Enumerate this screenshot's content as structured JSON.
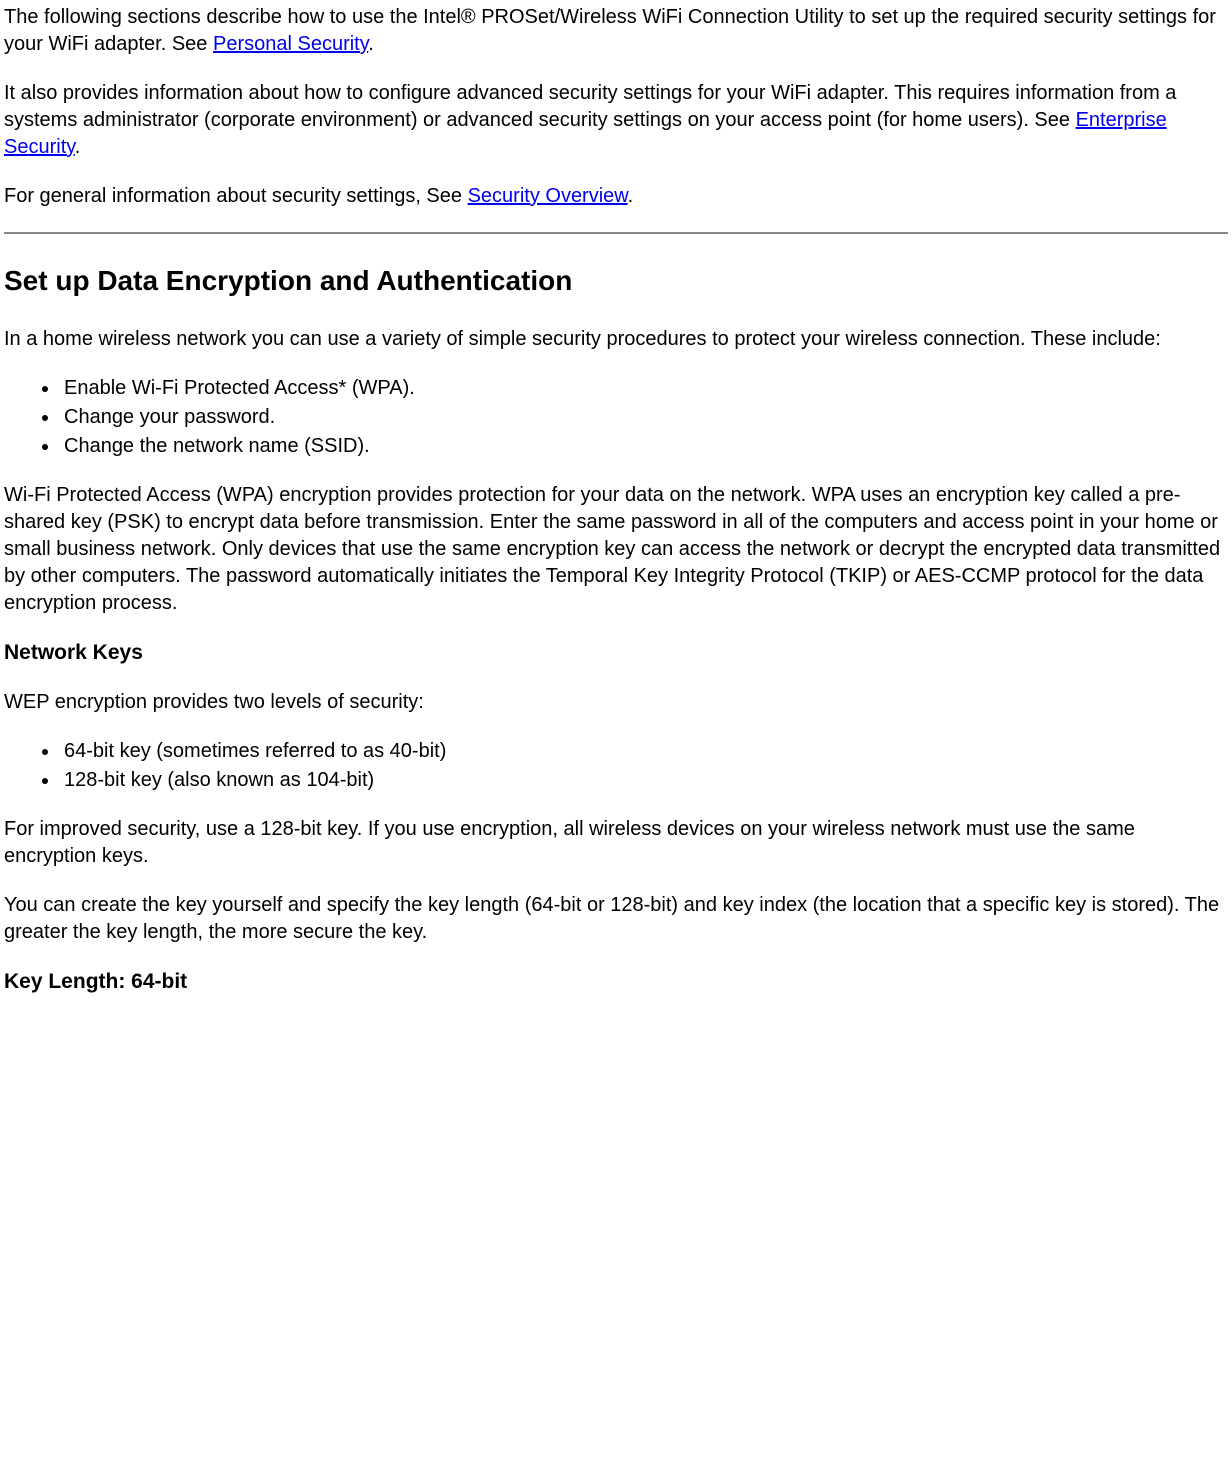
{
  "p1_a": "The following sections describe how to use the Intel® PROSet/Wireless WiFi Connection Utility to set up the required security settings for your WiFi adapter. See ",
  "p1_link": "Personal Security",
  "p1_b": ".",
  "p2_a": "It also provides information about how to configure advanced security settings for your WiFi adapter. This requires information from a systems administrator (corporate environment) or advanced security settings on your access point (for home users). See ",
  "p2_link": "Enterprise Security",
  "p2_b": ".",
  "p3_a": "For general information about security settings, See ",
  "p3_link": "Security Overview",
  "p3_b": ".",
  "h_encryption": "Set up Data Encryption and Authentication",
  "p4": "In a home wireless network you can use a variety of simple security procedures to protect your wireless connection. These include:",
  "list1": {
    "i0": "Enable Wi-Fi Protected Access* (WPA).",
    "i1": "Change your password.",
    "i2": "Change the network name (SSID)."
  },
  "p5": "Wi-Fi Protected Access (WPA) encryption provides protection for your data on the network. WPA uses an encryption key called a pre-shared key (PSK) to encrypt data before transmission. Enter the same password in all of the computers and access point in your home or small business network. Only devices that use the same encryption key can access the network or decrypt the encrypted data transmitted by other computers. The password automatically initiates the Temporal Key Integrity Protocol (TKIP) or AES-CCMP protocol for the data encryption process.",
  "h_networkkeys": "Network Keys",
  "p6": "WEP encryption provides two levels of security:",
  "list2": {
    "i0": "64-bit key (sometimes referred to as 40-bit)",
    "i1": "128-bit key (also known as 104-bit)"
  },
  "p7": "For improved security, use a 128-bit key. If you use encryption, all wireless devices on your wireless network must use the same encryption keys.",
  "p8": "You can create the key yourself and specify the key length (64-bit or 128-bit) and key index (the location that a specific key is stored). The greater the key length, the more secure the key.",
  "h_keylength": "Key Length: 64-bit"
}
